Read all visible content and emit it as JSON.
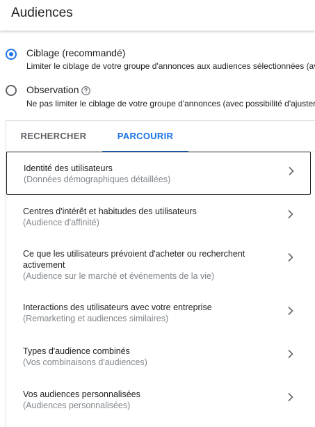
{
  "header": {
    "title": "Audiences"
  },
  "targeting": {
    "options": [
      {
        "label": "Ciblage (recommandé)",
        "description": "Limiter le ciblage de votre groupe d'annonces aux audiences sélectionnées (av",
        "checked": true
      },
      {
        "label": "Observation",
        "description": "Ne pas limiter le ciblage de votre groupe d'annonces (avec possibilité d'ajuster",
        "checked": false,
        "icon": "help-icon"
      }
    ]
  },
  "tabs": [
    {
      "label": "RECHERCHER",
      "active": false
    },
    {
      "label": "PARCOURIR",
      "active": true
    }
  ],
  "browse_items": [
    {
      "title": "Identité des utilisateurs",
      "subtitle": "(Données démographiques détaillées)",
      "selected": true
    },
    {
      "title": "Centres d'intérêt et habitudes des utilisateurs",
      "subtitle": "(Audience d'affinité)",
      "selected": false
    },
    {
      "title": "Ce que les utilisateurs prévoient d'acheter ou recherchent activement",
      "subtitle": "(Audience sur le marché et événements de la vie)",
      "selected": false
    },
    {
      "title": "Interactions des utilisateurs avec votre entreprise",
      "subtitle": "(Remarketing et audiences similaires)",
      "selected": false
    },
    {
      "title": "Types d'audience combinés",
      "subtitle": "(Vos combinaisons d'audiences)",
      "selected": false
    },
    {
      "title": "Vos audiences personnalisées",
      "subtitle": "(Audiences personnalisées)",
      "selected": false
    }
  ],
  "colors": {
    "accent": "#1a73e8",
    "text": "#202124",
    "secondary_text": "#80868b",
    "divider": "#dadce0"
  }
}
